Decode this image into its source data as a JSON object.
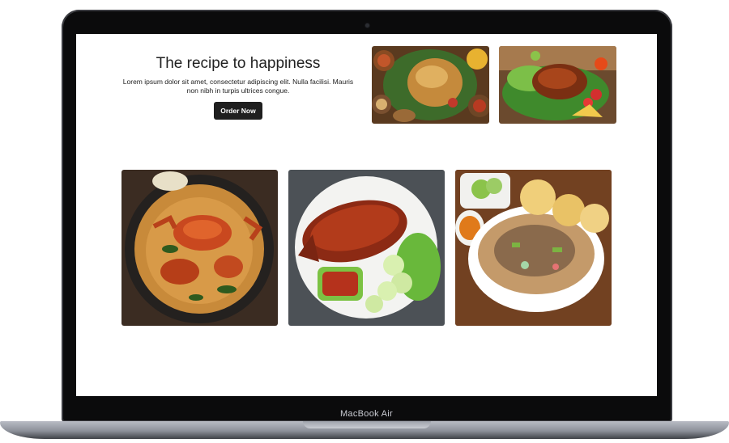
{
  "laptop": {
    "brand_label": "MacBook Air"
  },
  "hero": {
    "title": "The recipe to happiness",
    "description": "Lorem ipsum dolor sit amet, consectetur adipiscing elit. Nulla facilisi. Mauris non nibh in turpis ultrices congue.",
    "cta_label": "Order Now"
  },
  "gallery": {
    "top": [
      "rice-platter-photo",
      "grilled-chicken-photo"
    ],
    "bottom": [
      "crab-curry-photo",
      "grilled-fish-photo",
      "soto-soup-photo"
    ]
  }
}
